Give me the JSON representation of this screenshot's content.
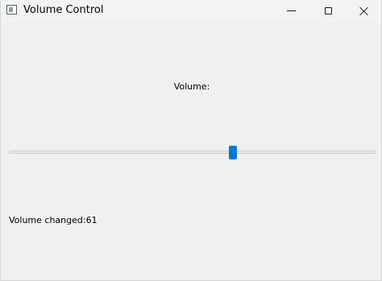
{
  "window": {
    "title": "Volume Control",
    "icons": {
      "app": "app-window-icon",
      "minimize": "minimize-icon",
      "maximize": "maximize-icon",
      "close": "close-icon"
    }
  },
  "main": {
    "volume_label": "Volume:",
    "slider": {
      "value": 61,
      "min": 0,
      "max": 100,
      "accent_color": "#0078d4"
    },
    "status_text": "Volume changed:61"
  }
}
